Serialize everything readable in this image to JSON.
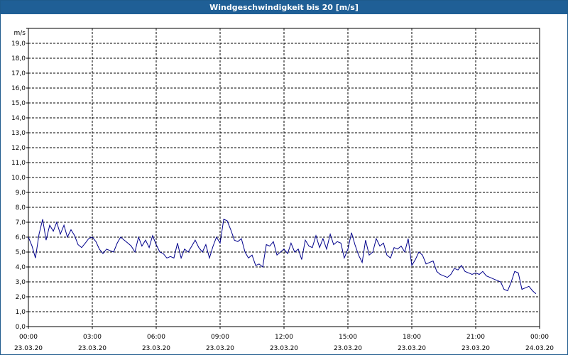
{
  "title": "Windgeschwindigkeit bis 20 [m/s]",
  "colors": {
    "titlebar": "#1f5f96",
    "series": "#00008b",
    "grid": "#000000"
  },
  "chart_data": {
    "type": "line",
    "title": "Windgeschwindigkeit bis 20 [m/s]",
    "ylabel": "m/s",
    "ylim": [
      0,
      20
    ],
    "yticks": [
      "0,0",
      "1,0",
      "2,0",
      "3,0",
      "4,0",
      "5,0",
      "6,0",
      "7,0",
      "8,0",
      "9,0",
      "10,0",
      "11,0",
      "12,0",
      "13,0",
      "14,0",
      "15,0",
      "16,0",
      "17,0",
      "18,0",
      "19,0"
    ],
    "xlim_hours": [
      0,
      24
    ],
    "xticks": [
      {
        "time": "00:00",
        "date": "23.03.20"
      },
      {
        "time": "03:00",
        "date": "23.03.20"
      },
      {
        "time": "06:00",
        "date": "23.03.20"
      },
      {
        "time": "09:00",
        "date": "23.03.20"
      },
      {
        "time": "12:00",
        "date": "23.03.20"
      },
      {
        "time": "15:00",
        "date": "23.03.20"
      },
      {
        "time": "18:00",
        "date": "23.03.20"
      },
      {
        "time": "21:00",
        "date": "23.03.20"
      },
      {
        "time": "00:00",
        "date": "24.03.20"
      }
    ],
    "grid": true,
    "series": [
      {
        "color": "#00008b",
        "x_hours": [
          0,
          0.17,
          0.33,
          0.5,
          0.67,
          0.83,
          1,
          1.17,
          1.33,
          1.5,
          1.67,
          1.83,
          2,
          2.17,
          2.33,
          2.5,
          2.67,
          2.83,
          3,
          3.17,
          3.33,
          3.5,
          3.67,
          3.83,
          4,
          4.17,
          4.33,
          4.5,
          4.67,
          4.83,
          5,
          5.17,
          5.33,
          5.5,
          5.67,
          5.83,
          6,
          6.17,
          6.33,
          6.5,
          6.67,
          6.83,
          7,
          7.17,
          7.33,
          7.5,
          7.67,
          7.83,
          8,
          8.17,
          8.33,
          8.5,
          8.67,
          8.83,
          9,
          9.17,
          9.33,
          9.5,
          9.67,
          9.83,
          10,
          10.17,
          10.33,
          10.5,
          10.67,
          10.83,
          11,
          11.17,
          11.33,
          11.5,
          11.67,
          11.83,
          12,
          12.17,
          12.33,
          12.5,
          12.67,
          12.83,
          13,
          13.17,
          13.33,
          13.5,
          13.67,
          13.83,
          14,
          14.17,
          14.33,
          14.5,
          14.67,
          14.83,
          15,
          15.17,
          15.33,
          15.5,
          15.67,
          15.83,
          16,
          16.17,
          16.33,
          16.5,
          16.67,
          16.83,
          17,
          17.17,
          17.33,
          17.5,
          17.67,
          17.83,
          18,
          18.17,
          18.33,
          18.5,
          18.67,
          18.83,
          19,
          19.17,
          19.33,
          19.5,
          19.67,
          19.83,
          20,
          20.17,
          20.33,
          20.5,
          20.67,
          20.83,
          21,
          21.17,
          21.33,
          21.5,
          21.67,
          21.83,
          22,
          22.17,
          22.33,
          22.5,
          22.67,
          22.83,
          23,
          23.17,
          23.33,
          23.5,
          23.67,
          23.83
        ],
        "y": [
          6.0,
          5.4,
          4.6,
          6.2,
          7.2,
          5.8,
          6.8,
          6.4,
          7.0,
          6.2,
          6.8,
          6.0,
          6.5,
          6.1,
          5.5,
          5.3,
          5.6,
          5.9,
          6.0,
          5.7,
          5.2,
          4.9,
          5.2,
          5.1,
          5.0,
          5.6,
          6.0,
          5.8,
          5.6,
          5.4,
          5.0,
          6.0,
          5.4,
          5.8,
          5.3,
          6.1,
          5.5,
          5.0,
          4.9,
          4.6,
          4.7,
          4.6,
          5.6,
          4.6,
          5.2,
          5.0,
          5.4,
          5.8,
          5.3,
          5.0,
          5.5,
          4.6,
          5.4,
          6.0,
          5.6,
          7.2,
          7.1,
          6.5,
          5.8,
          5.7,
          5.9,
          5.0,
          4.6,
          4.8,
          4.1,
          4.2,
          4.0,
          5.5,
          5.4,
          5.7,
          4.8,
          5.0,
          5.2,
          4.9,
          5.6,
          5.0,
          5.2,
          4.5,
          5.8,
          5.4,
          5.3,
          6.1,
          5.3,
          5.9,
          5.2,
          6.2,
          5.5,
          5.7,
          5.6,
          4.6,
          5.2,
          6.3,
          5.5,
          4.8,
          4.3,
          5.8,
          4.8,
          5.0,
          5.9,
          5.4,
          5.6,
          4.8,
          4.6,
          5.3,
          5.2,
          5.4,
          5.0,
          5.9,
          4.1,
          4.5,
          5.0,
          4.8,
          4.2,
          4.3,
          4.4,
          3.7,
          3.5,
          3.4,
          3.3,
          3.5,
          3.9,
          3.8,
          4.1,
          3.7,
          3.6,
          3.5,
          3.6,
          3.5,
          3.7,
          3.4,
          3.3,
          3.2,
          3.1,
          3.0,
          2.5,
          2.4,
          3.0,
          3.7,
          3.6,
          2.5,
          2.6,
          2.7,
          2.4,
          2.2
        ]
      }
    ]
  }
}
